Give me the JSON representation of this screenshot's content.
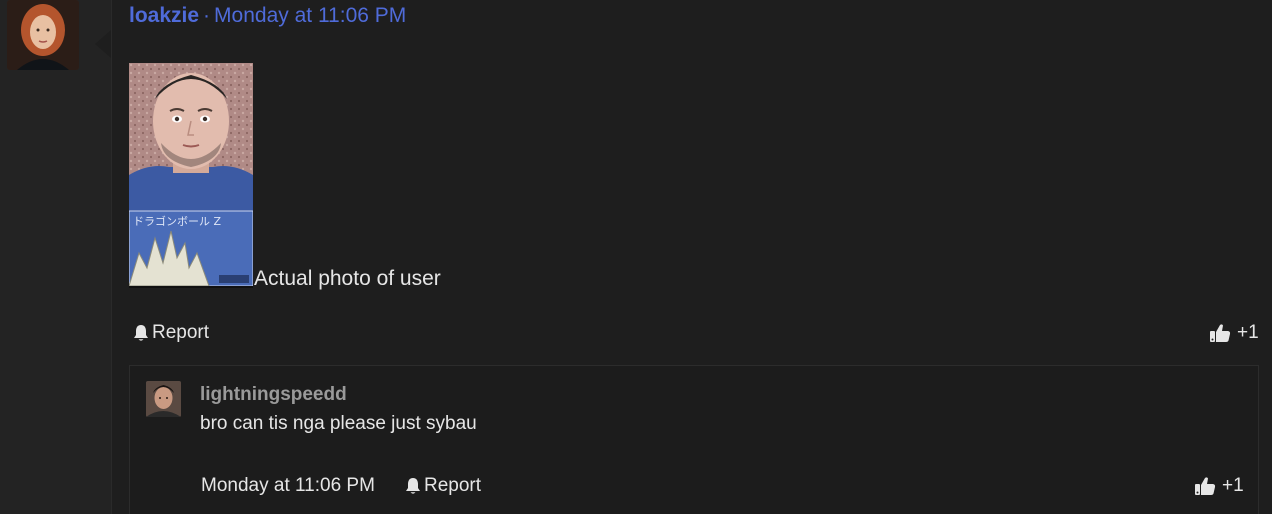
{
  "post": {
    "author": "loakzie",
    "separator": "·",
    "timestamp": "Monday at 11:06 PM",
    "caption": "Actual photo of user",
    "report_label": "Report",
    "like_label": "+1",
    "avatar_icon": "user-avatar-portrait",
    "image_desc": "user-photo"
  },
  "reply": {
    "author": "lightningspeedd",
    "text": "bro can tis nga please just sybau",
    "timestamp": "Monday at 11:06 PM",
    "report_label": "Report",
    "like_label": "+1",
    "avatar_icon": "user-avatar-portrait"
  },
  "colors": {
    "background": "#1e1e1e",
    "username_link": "#4f6bd9",
    "reply_username": "#9a9a9a",
    "text": "#e6e6e6"
  }
}
